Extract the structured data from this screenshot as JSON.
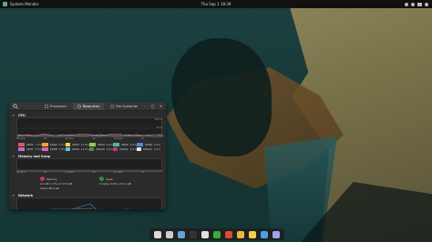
{
  "topbar": {
    "app_name": "System Monitor",
    "clock": "Thu Sep 1  18:39"
  },
  "window": {
    "tabs": [
      {
        "label": "Processes",
        "active": false
      },
      {
        "label": "Resources",
        "active": true
      },
      {
        "label": "File Systems",
        "active": false
      }
    ],
    "cpu": {
      "title": "CPU",
      "axis": [
        "100 %",
        "50 %",
        "0 %"
      ],
      "time_labels": [
        "60 secs",
        "50",
        "40 secs",
        "30",
        "20 secs",
        "10",
        ""
      ],
      "cores": [
        {
          "name": "CPU1",
          "value": "7.9%",
          "color": "#e05a4e"
        },
        {
          "name": "CPU2",
          "value": "3.5%",
          "color": "#f2a33c"
        },
        {
          "name": "CPU3",
          "value": "17.8%",
          "color": "#f1d949"
        },
        {
          "name": "CPU4",
          "value": "4.9%",
          "color": "#8ad05a"
        },
        {
          "name": "CPU5",
          "value": "4.0%",
          "color": "#4bb9a5"
        },
        {
          "name": "CPU6",
          "value": "2.0%",
          "color": "#4a89e0"
        },
        {
          "name": "CPU7",
          "value": "5.0%",
          "color": "#c466e0"
        },
        {
          "name": "CPU8",
          "value": "7.8%",
          "color": "#e0639e"
        },
        {
          "name": "CPU9",
          "value": "11.0%",
          "color": "#5ac4e0"
        },
        {
          "name": "CPU10",
          "value": "4.0%",
          "color": "#5a8a3a"
        },
        {
          "name": "CPU11",
          "value": "4.0%",
          "color": "#c9367b"
        },
        {
          "name": "CPU12",
          "value": "1.0%",
          "color": "#e6e6e6"
        }
      ]
    },
    "memory": {
      "title": "Memory and Swap",
      "time_labels": [
        "60 secs",
        "50",
        "40 secs",
        "30",
        "20 secs",
        "10",
        ""
      ],
      "memory_label": "Memory",
      "memory_value": "2.4 GB (1.7%) of 13.5 GB",
      "cache_value": "Cache 66.0 GB",
      "swap_label": "Swap",
      "swap_value": "0 bytes (0.0%) of 2.1 GB",
      "memory_color": "#b23a7e",
      "swap_color": "#3a8a3a"
    },
    "network": {
      "title": "Network",
      "axis": [
        "",
        ""
      ]
    }
  },
  "dock": {
    "items": [
      {
        "name": "files-icon",
        "color": "#d9d9d9"
      },
      {
        "name": "camera-icon",
        "color": "#cccccc"
      },
      {
        "name": "gear-icon",
        "color": "#6aa0d8"
      },
      {
        "name": "terminal-icon",
        "color": "#333333"
      },
      {
        "name": "calendar-icon",
        "color": "#e0e0e0"
      },
      {
        "name": "chart-icon",
        "color": "#3aaa3a"
      },
      {
        "name": "browser-icon",
        "color": "#d94a3a"
      },
      {
        "name": "chrome-icon",
        "color": "#e6b93a"
      },
      {
        "name": "notes-icon",
        "color": "#f0d04a"
      },
      {
        "name": "photos-icon",
        "color": "#4aa0e0"
      },
      {
        "name": "apps-icon",
        "color": "#9aa5e8"
      }
    ]
  }
}
